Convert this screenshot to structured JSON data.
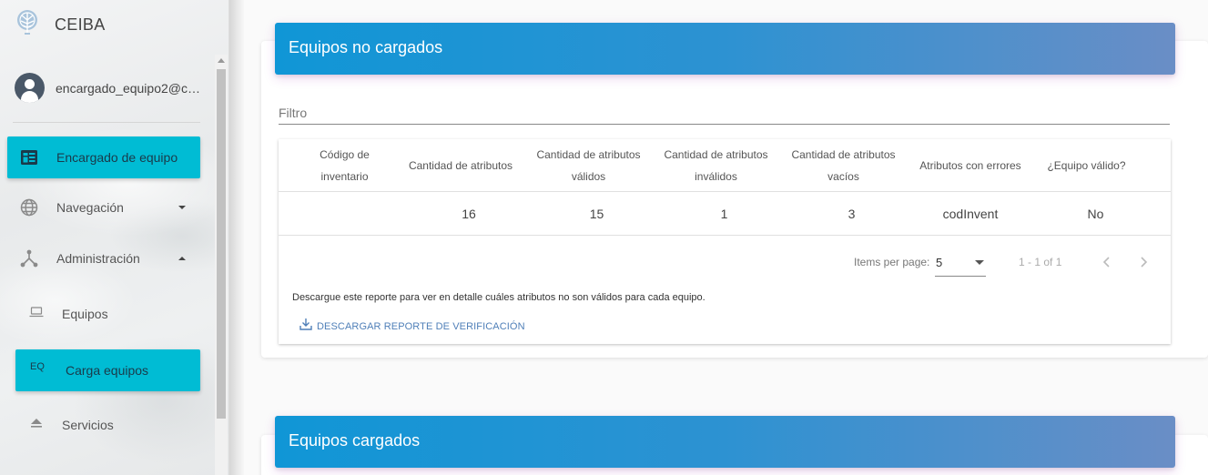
{
  "app": {
    "name": "CEIBA"
  },
  "user": {
    "email": "encargado_equipo2@ceiba"
  },
  "sidebar": {
    "items": [
      {
        "label": "Encargado de equipo"
      },
      {
        "label": "Navegación"
      },
      {
        "label": "Administración"
      },
      {
        "label": "Equipos"
      },
      {
        "label": "Carga equipos",
        "abbr": "EQ"
      },
      {
        "label": "Servicios"
      }
    ]
  },
  "cards": {
    "not_loaded": {
      "title": "Equipos no cargados",
      "filter_placeholder": "Filtro",
      "columns": [
        "Código de inventario",
        "Cantidad de atributos",
        "Cantidad de atributos válidos",
        "Cantidad de atributos inválidos",
        "Cantidad de atributos vacíos",
        "Atributos con errores",
        "¿Equipo válido?"
      ],
      "rows": [
        [
          "",
          "16",
          "15",
          "1",
          "3",
          "codInvent",
          "No"
        ]
      ],
      "paginator": {
        "items_per_page_label": "Items per page:",
        "page_size": "5",
        "range": "1 - 1 of 1"
      },
      "note": "Descargue este reporte para ver en detalle cuáles atributos no son válidos para cada equipo.",
      "download_label": "DESCARGAR REPORTE DE VERIFICACIÓN"
    },
    "loaded": {
      "title": "Equipos cargados"
    }
  },
  "colors": {
    "accent": "#00bcd4",
    "header_start": "#1096d6",
    "header_end": "#6a8ec6",
    "link": "#4f7fb8"
  }
}
